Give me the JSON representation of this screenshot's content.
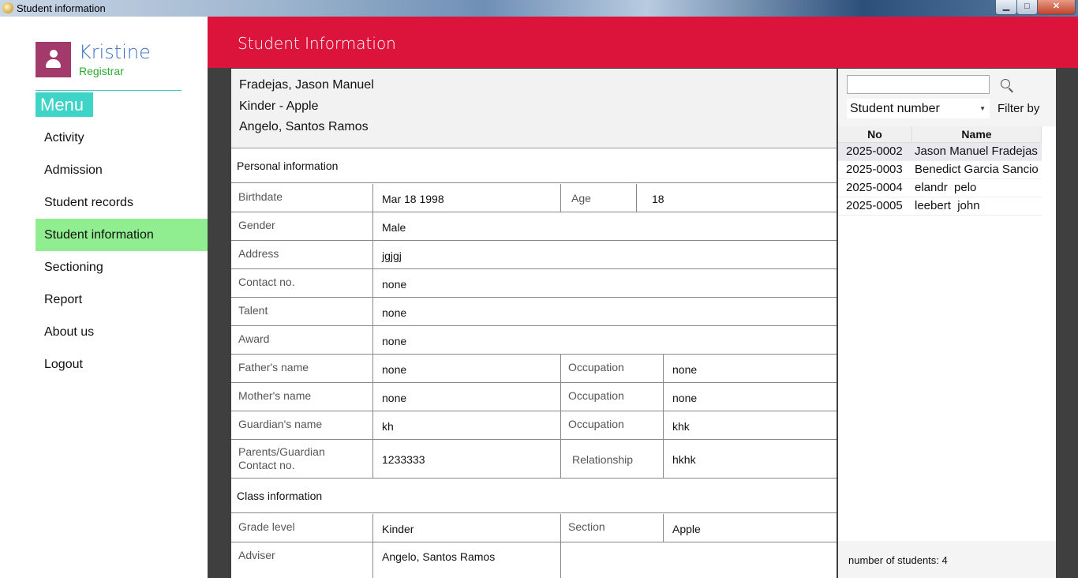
{
  "window": {
    "title": "Student information"
  },
  "sidebar": {
    "user_name": "Kristine",
    "user_role": "Registrar",
    "menu_label": "Menu",
    "items": [
      {
        "label": "Activity"
      },
      {
        "label": "Admission"
      },
      {
        "label": "Student records"
      },
      {
        "label": "Student information",
        "active": true
      },
      {
        "label": "Sectioning"
      },
      {
        "label": "Report"
      },
      {
        "label": "About us"
      },
      {
        "label": "Logout"
      }
    ]
  },
  "header": {
    "title": "Student Information"
  },
  "summary": {
    "name": "Fradejas, Jason Manuel",
    "class": "Kinder - Apple",
    "adviser": "Angelo, Santos Ramos"
  },
  "personal": {
    "section_title": "Personal information",
    "birthdate_label": "Birthdate",
    "birthdate": "Mar 18 1998",
    "age_label": "Age",
    "age": "18",
    "gender_label": "Gender",
    "gender": "Male",
    "address_label": "Address",
    "address": "jgjgj",
    "contact_label": "Contact no.",
    "contact": "none",
    "talent_label": "Talent",
    "talent": "none",
    "award_label": "Award",
    "award": "none",
    "father_label": "Father's name",
    "father": "none",
    "father_occ_label": "Occupation",
    "father_occ": "none",
    "mother_label": "Mother's name",
    "mother": "none",
    "mother_occ_label": "Occupation",
    "mother_occ": "none",
    "guardian_label": "Guardian's name",
    "guardian": "kh",
    "guardian_occ_label": "Occupation",
    "guardian_occ": "khk",
    "pg_contact_label_1": "Parents/Guardian",
    "pg_contact_label_2": "Contact no.",
    "pg_contact": "1233333",
    "relationship_label": "Relationship",
    "relationship": "hkhk"
  },
  "class_info": {
    "section_title": "Class information",
    "grade_label": "Grade level",
    "grade": "Kinder",
    "section_label": "Section",
    "section": "Apple",
    "adviser_label": "Adviser",
    "adviser": "Angelo, Santos Ramos"
  },
  "search": {
    "value": "",
    "filter_value": "Student number",
    "filter_label": "Filter by"
  },
  "students_table": {
    "col_no": "No",
    "col_name": "Name",
    "rows": [
      {
        "no": "2025-0002",
        "name": "Jason Manuel Fradejas"
      },
      {
        "no": "2025-0003",
        "name": "Benedict Garcia Sancio"
      },
      {
        "no": "2025-0004",
        "name": "elandr  pelo"
      },
      {
        "no": "2025-0005",
        "name": "leebert  john"
      }
    ]
  },
  "footer": {
    "count_text": "number of students: 4"
  },
  "colors": {
    "header": "#dc143c",
    "active_nav": "#90ee90",
    "menu_label": "#3fd4c8",
    "avatar": "#a23a6c"
  }
}
